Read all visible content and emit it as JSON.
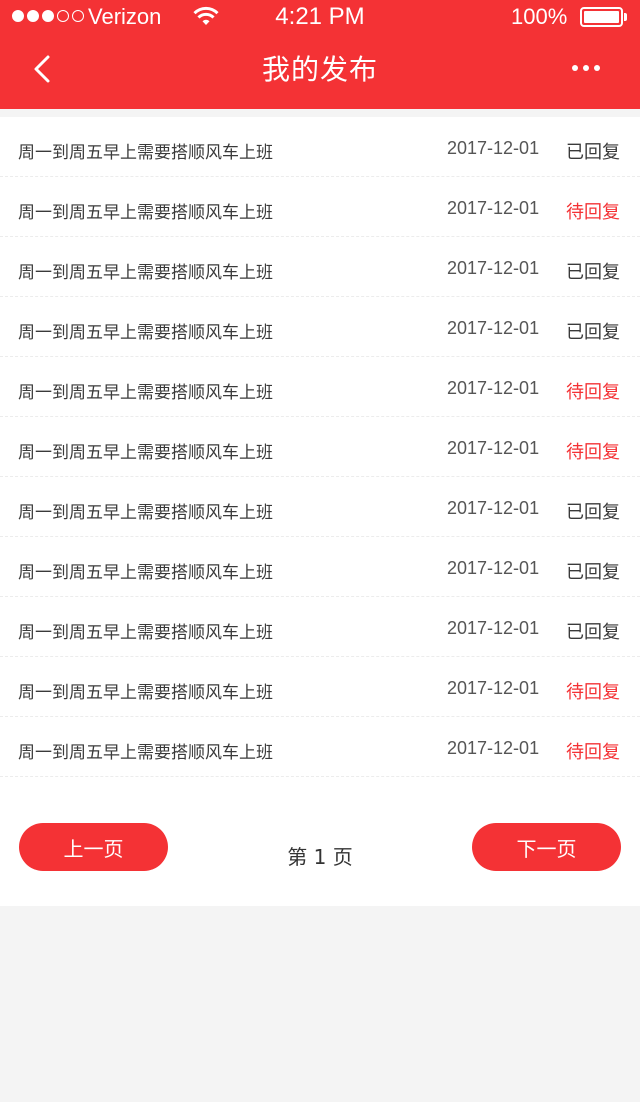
{
  "status_bar": {
    "carrier": "Verizon",
    "time": "4:21 PM",
    "battery": "100%",
    "signal_bars_filled": 3,
    "signal_bars_total": 5
  },
  "nav": {
    "title": "我的发布",
    "back_icon": "chevron-left-icon",
    "more_icon": "more-dots-icon"
  },
  "colors": {
    "brand": "#f43235",
    "replied": "#3a3a3a",
    "pending": "#f43235"
  },
  "posts": [
    {
      "title": "周一到周五早上需要搭顺风车上班",
      "date": "2017-12-01",
      "status": "已回复",
      "pending": false
    },
    {
      "title": "周一到周五早上需要搭顺风车上班",
      "date": "2017-12-01",
      "status": "待回复",
      "pending": true
    },
    {
      "title": "周一到周五早上需要搭顺风车上班",
      "date": "2017-12-01",
      "status": "已回复",
      "pending": false
    },
    {
      "title": "周一到周五早上需要搭顺风车上班",
      "date": "2017-12-01",
      "status": "已回复",
      "pending": false
    },
    {
      "title": "周一到周五早上需要搭顺风车上班",
      "date": "2017-12-01",
      "status": "待回复",
      "pending": true
    },
    {
      "title": "周一到周五早上需要搭顺风车上班",
      "date": "2017-12-01",
      "status": "待回复",
      "pending": true
    },
    {
      "title": "周一到周五早上需要搭顺风车上班",
      "date": "2017-12-01",
      "status": "已回复",
      "pending": false
    },
    {
      "title": "周一到周五早上需要搭顺风车上班",
      "date": "2017-12-01",
      "status": "已回复",
      "pending": false
    },
    {
      "title": "周一到周五早上需要搭顺风车上班",
      "date": "2017-12-01",
      "status": "已回复",
      "pending": false
    },
    {
      "title": "周一到周五早上需要搭顺风车上班",
      "date": "2017-12-01",
      "status": "待回复",
      "pending": true
    },
    {
      "title": "周一到周五早上需要搭顺风车上班",
      "date": "2017-12-01",
      "status": "待回复",
      "pending": true
    }
  ],
  "pagination": {
    "prev_label": "上一页",
    "next_label": "下一页",
    "page_label": "第 1 页",
    "current_page": 1
  }
}
